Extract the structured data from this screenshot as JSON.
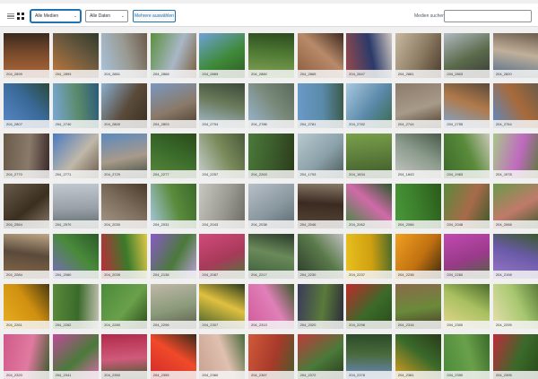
{
  "toolbar": {
    "filter_select": "Alle Medien",
    "date_select": "Alle Daten",
    "bulk_select_button": "Mehrere auswählen",
    "search_label": "Medien suchen",
    "search_value": ""
  },
  "media": [
    {
      "id": "204_2899",
      "colors": [
        "#b06a3a",
        "#7a4a2c",
        "#3a2a1e"
      ]
    },
    {
      "id": "204_2893",
      "colors": [
        "#c77b3a",
        "#6d5a3f",
        "#2f3b2a"
      ]
    },
    {
      "id": "204_2861",
      "colors": [
        "#a9c4e0",
        "#9a9a92",
        "#6b5a4a"
      ]
    },
    {
      "id": "204_2868",
      "colors": [
        "#5b8f3e",
        "#a9b7c6",
        "#7a5c3a"
      ]
    },
    {
      "id": "204_2869",
      "colors": [
        "#6ea2d8",
        "#3f8a3a",
        "#2f5a22"
      ]
    },
    {
      "id": "204_2860",
      "colors": [
        "#87a45a",
        "#4f7a33",
        "#2b4a1f"
      ]
    },
    {
      "id": "204_2865",
      "colors": [
        "#8b5a3c",
        "#b88a6a",
        "#3e2a20"
      ]
    },
    {
      "id": "204_2847",
      "colors": [
        "#9b4a4a",
        "#2a3a6a",
        "#d0c8c0"
      ]
    },
    {
      "id": "204_2881",
      "colors": [
        "#c9b8a0",
        "#8a7a62",
        "#4a3a2a"
      ]
    },
    {
      "id": "204_2803",
      "colors": [
        "#b0b8c0",
        "#5a6a4a",
        "#3a3a3a"
      ]
    },
    {
      "id": "204_2820",
      "colors": [
        "#4a6a8a",
        "#c0b09a",
        "#6a5a4a"
      ]
    },
    {
      "id": "204_2807",
      "colors": [
        "#5a8ac8",
        "#3a6a9a",
        "#2a4a3a"
      ]
    },
    {
      "id": "204_2740",
      "colors": [
        "#7aa8d8",
        "#5a8a6a",
        "#2a5a7a"
      ]
    },
    {
      "id": "204_2800",
      "colors": [
        "#8ab0d0",
        "#5a4a3a",
        "#3a3020"
      ]
    },
    {
      "id": "204_2803",
      "colors": [
        "#7a98c0",
        "#8a7a6a",
        "#4a3a2a"
      ]
    },
    {
      "id": "204_2794",
      "colors": [
        "#a8c0d8",
        "#6a7a5a",
        "#3a4a3a"
      ]
    },
    {
      "id": "204_2786",
      "colors": [
        "#9ab8d4",
        "#7a8a7a",
        "#5a6a5a"
      ]
    },
    {
      "id": "204_2781",
      "colors": [
        "#6a9ac8",
        "#5a8aa8",
        "#3a5a4a"
      ]
    },
    {
      "id": "204_2782",
      "colors": [
        "#a8c8e0",
        "#5a88a8",
        "#3a6a4a"
      ]
    },
    {
      "id": "204_2744",
      "colors": [
        "#8a7a6a",
        "#a89a88",
        "#4a3a2a"
      ]
    },
    {
      "id": "204_2755",
      "colors": [
        "#7aa8d8",
        "#b07a4a",
        "#5a4a3a"
      ]
    },
    {
      "id": "204_2764",
      "colors": [
        "#5a8ac8",
        "#a86a3a",
        "#6a5a4a"
      ]
    },
    {
      "id": "204_2770",
      "colors": [
        "#6a5a4a",
        "#8a7a6a",
        "#3a2a2a"
      ]
    },
    {
      "id": "204_2771",
      "colors": [
        "#4a7ac0",
        "#c0b8a8",
        "#6a5a4a"
      ]
    },
    {
      "id": "204_2729",
      "colors": [
        "#5a8ac0",
        "#a89a8a",
        "#3a4a3a"
      ]
    },
    {
      "id": "204_2277",
      "colors": [
        "#5a8a3a",
        "#3a6a2a",
        "#2a4a1a"
      ]
    },
    {
      "id": "204_2257",
      "colors": [
        "#c8d0d0",
        "#7a8a5a",
        "#4a5a3a"
      ]
    },
    {
      "id": "204_2263",
      "colors": [
        "#4a7a3a",
        "#3a5a2a",
        "#2a3a1a"
      ]
    },
    {
      "id": "204_1793",
      "colors": [
        "#b8c8d0",
        "#8aa0a8",
        "#4a5a5a"
      ]
    },
    {
      "id": "204_1834",
      "colors": [
        "#7aa04a",
        "#5a7a3a",
        "#3a5a2a"
      ]
    },
    {
      "id": "204_1843",
      "colors": [
        "#c8c8c8",
        "#8a9a8a",
        "#4a5a4a"
      ]
    },
    {
      "id": "204_1963",
      "colors": [
        "#3a6a2a",
        "#5a8a3a",
        "#c8c8b8"
      ]
    },
    {
      "id": "204_1978",
      "colors": [
        "#a8c88a",
        "#c06ac0",
        "#5a7a3a"
      ]
    },
    {
      "id": "204_2564",
      "colors": [
        "#6a5a4a",
        "#3a3020",
        "#8a7a6a"
      ]
    },
    {
      "id": "204_2570",
      "colors": [
        "#c0c8d0",
        "#9aa0a8",
        "#5a6a6a"
      ]
    },
    {
      "id": "204_2030",
      "colors": [
        "#a89a88",
        "#7a6a5a",
        "#4a3a2a"
      ]
    },
    {
      "id": "204_2031",
      "colors": [
        "#a8c8e0",
        "#5a8a3a",
        "#3a6a2a"
      ]
    },
    {
      "id": "204_2043",
      "colors": [
        "#c8c8c0",
        "#9a9a92",
        "#6a6a62"
      ]
    },
    {
      "id": "204_2038",
      "colors": [
        "#b8c0c8",
        "#8a98a0",
        "#5a6a70"
      ]
    },
    {
      "id": "204_2046",
      "colors": [
        "#5a4a3a",
        "#3a2a20",
        "#8a7a6a"
      ]
    },
    {
      "id": "204_2062",
      "colors": [
        "#3a8a3a",
        "#d06aa8",
        "#2a5a2a"
      ]
    },
    {
      "id": "204_2066",
      "colors": [
        "#4a9a3a",
        "#3a7a2a",
        "#2a5a1a"
      ]
    },
    {
      "id": "204_2048",
      "colors": [
        "#5a8a3a",
        "#a86a4a",
        "#3a5a2a"
      ]
    },
    {
      "id": "204_2068",
      "colors": [
        "#6a9a4a",
        "#c07a6a",
        "#3a5a2a"
      ]
    },
    {
      "id": "204_2084",
      "colors": [
        "#8a6a4a",
        "#5a4a3a",
        "#c0a888"
      ]
    },
    {
      "id": "204_2080",
      "colors": [
        "#7a6ac0",
        "#4a8a3a",
        "#2a5a2a"
      ]
    },
    {
      "id": "204_2035",
      "colors": [
        "#c02a3a",
        "#3a7a2a",
        "#e0c84a"
      ]
    },
    {
      "id": "204_2136",
      "colors": [
        "#8a5ac8",
        "#4a7a3a",
        "#c0a0e0"
      ]
    },
    {
      "id": "204_2087",
      "colors": [
        "#d04a7a",
        "#a83a5a",
        "#4a7a3a"
      ]
    },
    {
      "id": "204_2217",
      "colors": [
        "#3a5a3a",
        "#6a8a5a",
        "#2a3a2a"
      ]
    },
    {
      "id": "204_2230",
      "colors": [
        "#2a3a2a",
        "#5a7a4a",
        "#c0c0c0"
      ]
    },
    {
      "id": "204_2237",
      "colors": [
        "#e8c020",
        "#d0a010",
        "#4a6a2a"
      ]
    },
    {
      "id": "204_2238",
      "colors": [
        "#f0a020",
        "#c07010",
        "#3a2a10"
      ]
    },
    {
      "id": "204_2260",
      "colors": [
        "#c04ab0",
        "#9a3a8a",
        "#4a6a3a"
      ]
    },
    {
      "id": "204_2198",
      "colors": [
        "#9a7ac8",
        "#6a5aa8",
        "#3a5a2a"
      ]
    },
    {
      "id": "204_2261",
      "colors": [
        "#e8b020",
        "#d09010",
        "#4a3a10"
      ]
    },
    {
      "id": "204_2262",
      "colors": [
        "#5a8a3a",
        "#3a6a2a",
        "#c0c0b0"
      ]
    },
    {
      "id": "204_2280",
      "colors": [
        "#4a8a3a",
        "#6aa04a",
        "#2a4a1a"
      ]
    },
    {
      "id": "204_2296",
      "colors": [
        "#c0b8a8",
        "#8a9a7a",
        "#5a5a4a"
      ]
    },
    {
      "id": "204_2307",
      "colors": [
        "#3a5a2a",
        "#e0c040",
        "#2a3a1a"
      ]
    },
    {
      "id": "204_2313",
      "colors": [
        "#d05a9a",
        "#e080b8",
        "#3a5a2a"
      ]
    },
    {
      "id": "204_2320",
      "colors": [
        "#3a3a5a",
        "#5a7a3a",
        "#2a2a3a"
      ]
    },
    {
      "id": "204_2298",
      "colors": [
        "#c02a2a",
        "#3a6a2a",
        "#2a4a1a"
      ]
    },
    {
      "id": "204_2316",
      "colors": [
        "#8a6a4a",
        "#6a8a3a",
        "#4a3a2a"
      ]
    },
    {
      "id": "204_2300",
      "colors": [
        "#e8d890",
        "#a8c060",
        "#4a6a2a"
      ]
    },
    {
      "id": "204_2295",
      "colors": [
        "#e8e0b0",
        "#a8c870",
        "#5a7a3a"
      ]
    },
    {
      "id": "204_2320",
      "colors": [
        "#d05a8a",
        "#e07aa0",
        "#3a5a2a"
      ]
    },
    {
      "id": "204_2341",
      "colors": [
        "#c04a9a",
        "#4a7a3a",
        "#e06ab0"
      ]
    },
    {
      "id": "204_2350",
      "colors": [
        "#b02a4a",
        "#d05a7a",
        "#3a5a2a"
      ]
    },
    {
      "id": "204_2355",
      "colors": [
        "#d02a2a",
        "#f04a2a",
        "#3a2a1a"
      ]
    },
    {
      "id": "204_2360",
      "colors": [
        "#c8a090",
        "#e0c0b0",
        "#4a6a3a"
      ]
    },
    {
      "id": "204_2367",
      "colors": [
        "#d05a3a",
        "#a83a2a",
        "#4a5a2a"
      ]
    },
    {
      "id": "204_2372",
      "colors": [
        "#c03a3a",
        "#4a7a3a",
        "#2a3a1a"
      ]
    },
    {
      "id": "204_2378",
      "colors": [
        "#6a8ac8",
        "#4a6a3a",
        "#2a4a2a"
      ]
    },
    {
      "id": "204_2381",
      "colors": [
        "#e0a020",
        "#3a6a2a",
        "#2a3a1a"
      ]
    },
    {
      "id": "204_2390",
      "colors": [
        "#4a8a3a",
        "#6aa04a",
        "#3a6a2a"
      ]
    },
    {
      "id": "204_2395",
      "colors": [
        "#c02a3a",
        "#3a6a2a",
        "#2a4a1a"
      ]
    }
  ]
}
